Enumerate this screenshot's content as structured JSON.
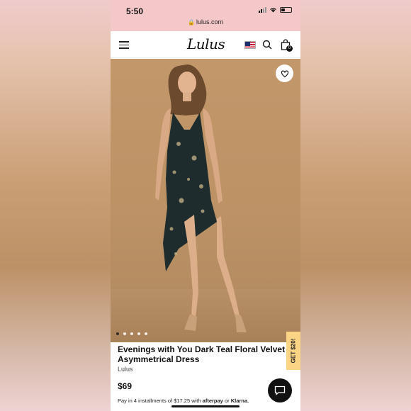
{
  "status_bar": {
    "time": "5:50",
    "url": "lulus.com"
  },
  "header": {
    "logo": "Lulus",
    "cart_count": "0"
  },
  "carousel": {
    "slide_count": 5,
    "active_index": 0
  },
  "promo_tab": {
    "label": "GET $20!"
  },
  "product": {
    "title": "Evenings with You Dark Teal Floral Velvet Asymmetrical Dress",
    "brand": "Lulus",
    "price": "$69",
    "installments_prefix": "Pay in 4 installments of $17.25 with",
    "afterpay_label": "afterpay",
    "or_label": "or",
    "klarna_label": "Klarna."
  },
  "colors": {
    "status_bar_bg": "#f4c7c9",
    "photo_bg": "#c2986b",
    "promo_bg": "#fbd486",
    "dress": "#1e2c2d"
  },
  "icons": [
    "hamburger-icon",
    "us-flag-icon",
    "search-icon",
    "shopping-bag-icon",
    "heart-icon",
    "chat-icon",
    "lock-icon",
    "wifi-icon",
    "battery-icon"
  ]
}
